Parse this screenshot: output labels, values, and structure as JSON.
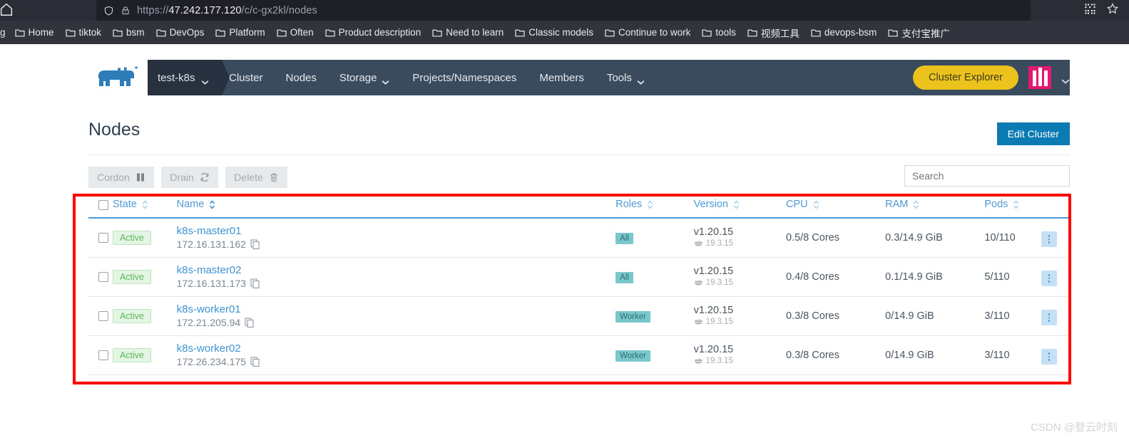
{
  "browser": {
    "url_prefix": "https://",
    "url_host": "47.242.177.120",
    "url_path": "/c/c-gx2kl/nodes",
    "home_stub_icon": "home-icon",
    "shield_icon": "shield-icon",
    "lock_warning_icon": "lock-warning-icon",
    "qr_icon": "qr-code-icon",
    "star_icon": "star-icon",
    "bookmark_stub": "g",
    "bookmarks": [
      {
        "label": "Home"
      },
      {
        "label": "tiktok"
      },
      {
        "label": "bsm"
      },
      {
        "label": "DevOps"
      },
      {
        "label": "Platform"
      },
      {
        "label": "Often"
      },
      {
        "label": "Product description"
      },
      {
        "label": "Need to learn"
      },
      {
        "label": "Classic models"
      },
      {
        "label": "Continue to work"
      },
      {
        "label": "tools"
      },
      {
        "label": "视频工具"
      },
      {
        "label": "devops-bsm"
      },
      {
        "label": "支付宝推广"
      }
    ]
  },
  "nav": {
    "logo_icon": "rancher-cow-logo",
    "cluster_name": "test-k8s",
    "cluster_chevron_icon": "chevron-down-icon",
    "links": [
      {
        "label": "Cluster",
        "has_dropdown": false
      },
      {
        "label": "Nodes",
        "has_dropdown": false
      },
      {
        "label": "Storage",
        "has_dropdown": true
      },
      {
        "label": "Projects/Namespaces",
        "has_dropdown": false
      },
      {
        "label": "Members",
        "has_dropdown": false
      },
      {
        "label": "Tools",
        "has_dropdown": true
      }
    ],
    "cluster_explorer_label": "Cluster Explorer",
    "avatar_icon": "user-avatar",
    "avatar_chevron_icon": "chevron-down-icon"
  },
  "page": {
    "title": "Nodes",
    "edit_cluster_label": "Edit Cluster"
  },
  "toolbar": {
    "cordon_label": "Cordon",
    "cordon_icon": "pause-icon",
    "drain_label": "Drain",
    "drain_icon": "sync-icon",
    "delete_label": "Delete",
    "delete_icon": "trash-icon",
    "search_placeholder": "Search",
    "search_value": ""
  },
  "table": {
    "columns": [
      {
        "label": "State",
        "sorted": false
      },
      {
        "label": "Name",
        "sorted": true
      },
      {
        "label": "Roles",
        "sorted": false
      },
      {
        "label": "Version",
        "sorted": false
      },
      {
        "label": "CPU",
        "sorted": false
      },
      {
        "label": "RAM",
        "sorted": false
      },
      {
        "label": "Pods",
        "sorted": false
      }
    ],
    "rows": [
      {
        "state": "Active",
        "name": "k8s-master01",
        "ip": "172.16.131.162",
        "role": "All",
        "version": "v1.20.15",
        "docker": "19.3.15",
        "cpu": "0.5/8 Cores",
        "ram": "0.3/14.9 GiB",
        "pods": "10/110"
      },
      {
        "state": "Active",
        "name": "k8s-master02",
        "ip": "172.16.131.173",
        "role": "All",
        "version": "v1.20.15",
        "docker": "19.3.15",
        "cpu": "0.4/8 Cores",
        "ram": "0.1/14.9 GiB",
        "pods": "5/110"
      },
      {
        "state": "Active",
        "name": "k8s-worker01",
        "ip": "172.21.205.94",
        "role": "Worker",
        "version": "v1.20.15",
        "docker": "19.3.15",
        "cpu": "0.3/8 Cores",
        "ram": "0/14.9 GiB",
        "pods": "3/110"
      },
      {
        "state": "Active",
        "name": "k8s-worker02",
        "ip": "172.26.234.175",
        "role": "Worker",
        "version": "v1.20.15",
        "docker": "19.3.15",
        "cpu": "0.3/8 Cores",
        "ram": "0/14.9 GiB",
        "pods": "3/110"
      }
    ]
  },
  "annotation": {
    "highlight_color": "#ff0000"
  },
  "watermark": "CSDN @登云时刻",
  "colors": {
    "nav_bg": "#3a4b5e",
    "cluster_bg": "#27313f",
    "accent_yellow": "#ecc21c",
    "accent_blue": "#0c7bb3",
    "link_blue": "#3d94d1",
    "role_teal": "#79c8cc",
    "state_green": "#5eb75e"
  }
}
